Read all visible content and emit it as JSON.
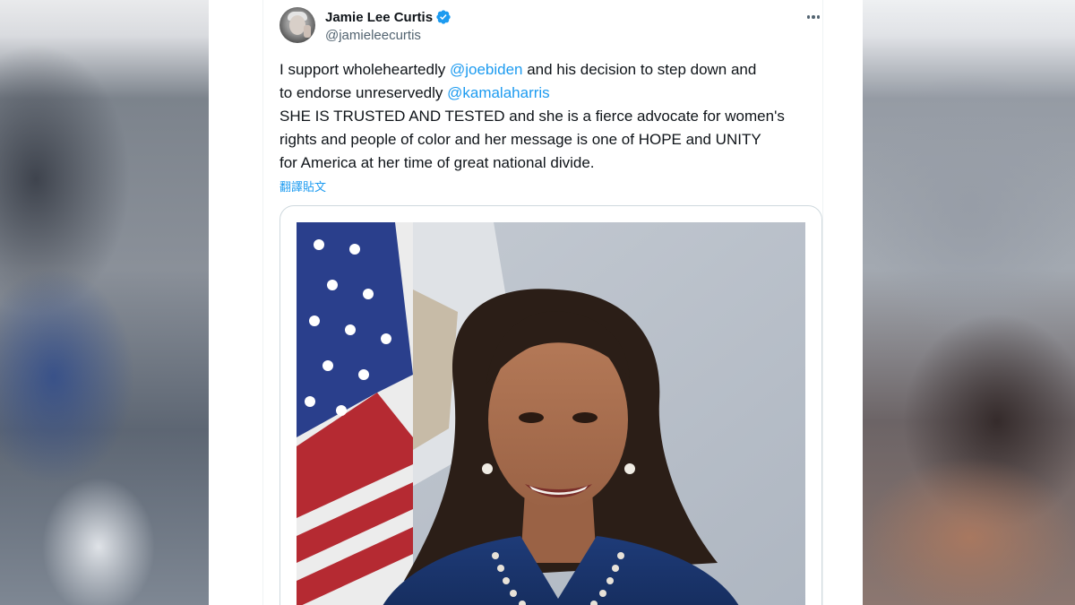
{
  "tweet": {
    "author": {
      "display_name": "Jamie Lee Curtis",
      "handle": "@jamieleecurtis",
      "verified_icon": "verified-badge-icon"
    },
    "body": {
      "line1_prefix": "I support wholeheartedly ",
      "mention1": "@joebiden",
      "line1_suffix": " and his decision to step down and",
      "line2_prefix": "to endorse unreservedly ",
      "mention2": "@kamalaharris",
      "line3": "SHE IS TRUSTED AND TESTED and she is a fierce advocate for women's",
      "line4": "rights and people of color and her message is one of HOPE and UNITY",
      "line5": "for America at her time of great national divide."
    },
    "translate_label": "翻譯貼文",
    "more_icon": "more-horizontal-icon"
  },
  "colors": {
    "link": "#1d9bf0",
    "text": "#0f1419",
    "secondary_text": "#536471",
    "border": "#cfd9de"
  }
}
